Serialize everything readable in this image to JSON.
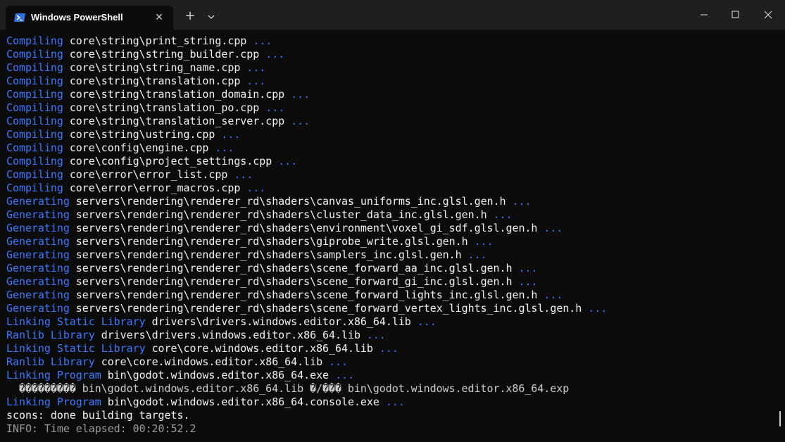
{
  "window": {
    "tab_title": "Windows PowerShell",
    "tab_close_glyph": "✕",
    "new_tab_glyph": "+",
    "icons": [
      "powershell-icon",
      "close-icon",
      "plus-icon",
      "chevron-down-icon",
      "minimize-icon",
      "maximize-icon",
      "close-icon"
    ]
  },
  "terminal": {
    "lines": [
      {
        "verb": "Compiling",
        "target": "core\\string\\print_string.cpp",
        "tail": " ..."
      },
      {
        "verb": "Compiling",
        "target": "core\\string\\string_builder.cpp",
        "tail": " ..."
      },
      {
        "verb": "Compiling",
        "target": "core\\string\\string_name.cpp",
        "tail": " ..."
      },
      {
        "verb": "Compiling",
        "target": "core\\string\\translation.cpp",
        "tail": " ..."
      },
      {
        "verb": "Compiling",
        "target": "core\\string\\translation_domain.cpp",
        "tail": " ..."
      },
      {
        "verb": "Compiling",
        "target": "core\\string\\translation_po.cpp",
        "tail": " ..."
      },
      {
        "verb": "Compiling",
        "target": "core\\string\\translation_server.cpp",
        "tail": " ..."
      },
      {
        "verb": "Compiling",
        "target": "core\\string\\ustring.cpp",
        "tail": " ..."
      },
      {
        "verb": "Compiling",
        "target": "core\\config\\engine.cpp",
        "tail": " ..."
      },
      {
        "verb": "Compiling",
        "target": "core\\config\\project_settings.cpp",
        "tail": " ..."
      },
      {
        "verb": "Compiling",
        "target": "core\\error\\error_list.cpp",
        "tail": " ..."
      },
      {
        "verb": "Compiling",
        "target": "core\\error\\error_macros.cpp",
        "tail": " ..."
      },
      {
        "verb": "Generating",
        "target": "servers\\rendering\\renderer_rd\\shaders\\canvas_uniforms_inc.glsl.gen.h",
        "tail": " ..."
      },
      {
        "verb": "Generating",
        "target": "servers\\rendering\\renderer_rd\\shaders\\cluster_data_inc.glsl.gen.h",
        "tail": " ..."
      },
      {
        "verb": "Generating",
        "target": "servers\\rendering\\renderer_rd\\shaders\\environment\\voxel_gi_sdf.glsl.gen.h",
        "tail": " ..."
      },
      {
        "verb": "Generating",
        "target": "servers\\rendering\\renderer_rd\\shaders\\giprobe_write.glsl.gen.h",
        "tail": " ..."
      },
      {
        "verb": "Generating",
        "target": "servers\\rendering\\renderer_rd\\shaders\\samplers_inc.glsl.gen.h",
        "tail": " ..."
      },
      {
        "verb": "Generating",
        "target": "servers\\rendering\\renderer_rd\\shaders\\scene_forward_aa_inc.glsl.gen.h",
        "tail": " ..."
      },
      {
        "verb": "Generating",
        "target": "servers\\rendering\\renderer_rd\\shaders\\scene_forward_gi_inc.glsl.gen.h",
        "tail": " ..."
      },
      {
        "verb": "Generating",
        "target": "servers\\rendering\\renderer_rd\\shaders\\scene_forward_lights_inc.glsl.gen.h",
        "tail": " ..."
      },
      {
        "verb": "Generating",
        "target": "servers\\rendering\\renderer_rd\\shaders\\scene_forward_vertex_lights_inc.glsl.gen.h",
        "tail": " ..."
      },
      {
        "verb": "Linking Static Library",
        "target": "drivers\\drivers.windows.editor.x86_64.lib",
        "tail": " ..."
      },
      {
        "verb": "Ranlib Library",
        "target": "drivers\\drivers.windows.editor.x86_64.lib",
        "tail": " ..."
      },
      {
        "verb": "Linking Static Library",
        "target": "core\\core.windows.editor.x86_64.lib",
        "tail": " ..."
      },
      {
        "verb": "Ranlib Library",
        "target": "core\\core.windows.editor.x86_64.lib",
        "tail": " ..."
      },
      {
        "verb": "Linking Program",
        "target": "bin\\godot.windows.editor.x86_64.exe",
        "tail": " ..."
      }
    ],
    "garbled_line": "  ���\u0002������ bin\\godot.windows.editor.x86_64.lib �\u0002/��� bin\\godot.windows.editor.x86_64.exp",
    "final_link": {
      "verb": "Linking Program",
      "target": "bin\\godot.windows.editor.x86_64.console.exe",
      "tail": " ..."
    },
    "done_line": "scons: done building targets.",
    "info_line": "INFO: Time elapsed: 00:20:52.2"
  },
  "colors": {
    "background": "#0c0c0c",
    "titlebar": "#1f1f1f",
    "verb_blue": "#3b78ff",
    "target_white": "#cccccc",
    "info_gray": "#9a9a9a"
  }
}
